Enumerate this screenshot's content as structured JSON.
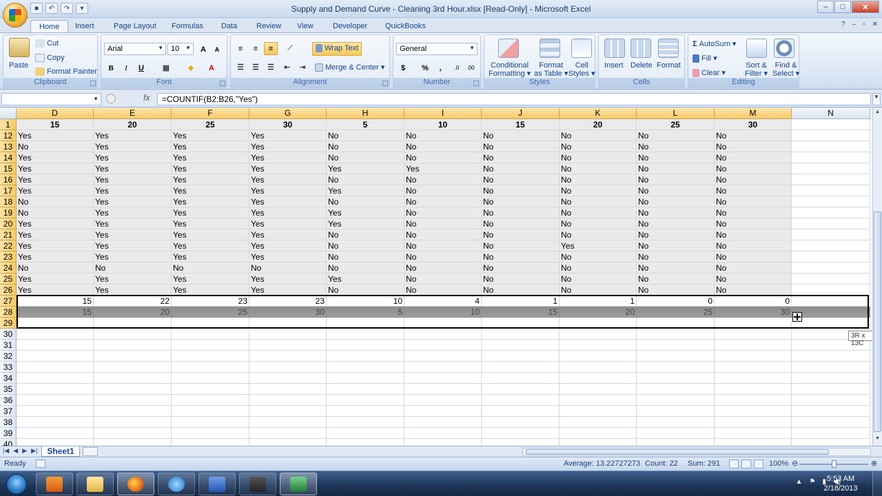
{
  "window": {
    "title": "Supply and Demand Curve - Cleaning 3rd Hour.xlsx  [Read-Only] - Microsoft Excel"
  },
  "ribbon_tabs": [
    "Home",
    "Insert",
    "Page Layout",
    "Formulas",
    "Data",
    "Review",
    "View",
    "Developer",
    "QuickBooks"
  ],
  "clipboard": {
    "paste": "Paste",
    "cut": "Cut",
    "copy": "Copy",
    "format_painter": "Format Painter",
    "label": "Clipboard"
  },
  "font": {
    "name": "Arial",
    "size": "10",
    "bold": "B",
    "italic": "I",
    "underline": "U",
    "label": "Font"
  },
  "alignment": {
    "wrap_text": "Wrap Text",
    "merge_center": "Merge & Center",
    "label": "Alignment"
  },
  "number": {
    "format": "General",
    "currency": "$",
    "percent": "%",
    "comma": ",",
    "label": "Number"
  },
  "styles": {
    "conditional_1": "Conditional",
    "conditional_2": "Formatting",
    "format_table_1": "Format",
    "format_table_2": "as Table",
    "cell_styles_1": "Cell",
    "cell_styles_2": "Styles",
    "label": "Styles"
  },
  "cells": {
    "insert": "Insert",
    "delete": "Delete",
    "format": "Format",
    "label": "Cells"
  },
  "editing": {
    "autosum": "AutoSum",
    "fill": "Fill",
    "clear": "Clear",
    "sort_1": "Sort &",
    "sort_2": "Filter",
    "find_1": "Find &",
    "find_2": "Select",
    "label": "Editing"
  },
  "formula_bar": {
    "name_box": "",
    "fx": "fx",
    "formula": "=COUNTIF(B2:B26,\"Yes\")"
  },
  "grid": {
    "columns": [
      "D",
      "E",
      "F",
      "G",
      "H",
      "I",
      "J",
      "K",
      "L",
      "M",
      "N"
    ],
    "row1_label": "1",
    "row1": [
      "15",
      "20",
      "25",
      "30",
      "5",
      "10",
      "15",
      "20",
      "25",
      "30",
      ""
    ],
    "rows": [
      {
        "n": "12",
        "v": [
          "Yes",
          "Yes",
          "Yes",
          "Yes",
          "No",
          "No",
          "No",
          "No",
          "No",
          "No"
        ]
      },
      {
        "n": "13",
        "v": [
          "No",
          "Yes",
          "Yes",
          "Yes",
          "No",
          "No",
          "No",
          "No",
          "No",
          "No"
        ]
      },
      {
        "n": "14",
        "v": [
          "Yes",
          "Yes",
          "Yes",
          "Yes",
          "No",
          "No",
          "No",
          "No",
          "No",
          "No"
        ]
      },
      {
        "n": "15",
        "v": [
          "Yes",
          "Yes",
          "Yes",
          "Yes",
          "Yes",
          "Yes",
          "No",
          "No",
          "No",
          "No"
        ]
      },
      {
        "n": "16",
        "v": [
          "Yes",
          "Yes",
          "Yes",
          "Yes",
          "No",
          "No",
          "No",
          "No",
          "No",
          "No"
        ]
      },
      {
        "n": "17",
        "v": [
          "Yes",
          "Yes",
          "Yes",
          "Yes",
          "Yes",
          "No",
          "No",
          "No",
          "No",
          "No"
        ]
      },
      {
        "n": "18",
        "v": [
          "No",
          "Yes",
          "Yes",
          "Yes",
          "No",
          "No",
          "No",
          "No",
          "No",
          "No"
        ]
      },
      {
        "n": "19",
        "v": [
          "No",
          "Yes",
          "Yes",
          "Yes",
          "Yes",
          "No",
          "No",
          "No",
          "No",
          "No"
        ]
      },
      {
        "n": "20",
        "v": [
          "Yes",
          "Yes",
          "Yes",
          "Yes",
          "Yes",
          "No",
          "No",
          "No",
          "No",
          "No"
        ]
      },
      {
        "n": "21",
        "v": [
          "Yes",
          "Yes",
          "Yes",
          "Yes",
          "No",
          "No",
          "No",
          "No",
          "No",
          "No"
        ]
      },
      {
        "n": "22",
        "v": [
          "Yes",
          "Yes",
          "Yes",
          "Yes",
          "No",
          "No",
          "No",
          "Yes",
          "No",
          "No"
        ]
      },
      {
        "n": "23",
        "v": [
          "Yes",
          "Yes",
          "Yes",
          "Yes",
          "No",
          "No",
          "No",
          "No",
          "No",
          "No"
        ]
      },
      {
        "n": "24",
        "v": [
          "No",
          "No",
          "No",
          "No",
          "No",
          "No",
          "No",
          "No",
          "No",
          "No"
        ]
      },
      {
        "n": "25",
        "v": [
          "Yes",
          "Yes",
          "Yes",
          "Yes",
          "Yes",
          "No",
          "No",
          "No",
          "No",
          "No"
        ]
      },
      {
        "n": "26",
        "v": [
          "Yes",
          "Yes",
          "Yes",
          "Yes",
          "No",
          "No",
          "No",
          "No",
          "No",
          "No"
        ]
      }
    ],
    "row27": {
      "n": "27",
      "v": [
        "15",
        "22",
        "23",
        "23",
        "10",
        "4",
        "1",
        "1",
        "0",
        "0"
      ]
    },
    "row28": {
      "n": "28",
      "v": [
        "15",
        "20",
        "25",
        "30",
        "5",
        "10",
        "15",
        "20",
        "25",
        "30"
      ]
    },
    "row29": {
      "n": "29"
    },
    "empty_rows": [
      "30",
      "31",
      "32",
      "33",
      "34",
      "35",
      "36",
      "37",
      "38",
      "39",
      "40"
    ],
    "drag_tooltip": "3R x 13C"
  },
  "sheet_tabs": [
    "Sheet1"
  ],
  "status": {
    "ready": "Ready",
    "average": "Average: 13.22727273",
    "count": "Count: 22",
    "sum": "Sum: 291",
    "zoom": "100%"
  },
  "taskbar": {
    "time": "5:53 AM",
    "date": "2/18/2013"
  }
}
